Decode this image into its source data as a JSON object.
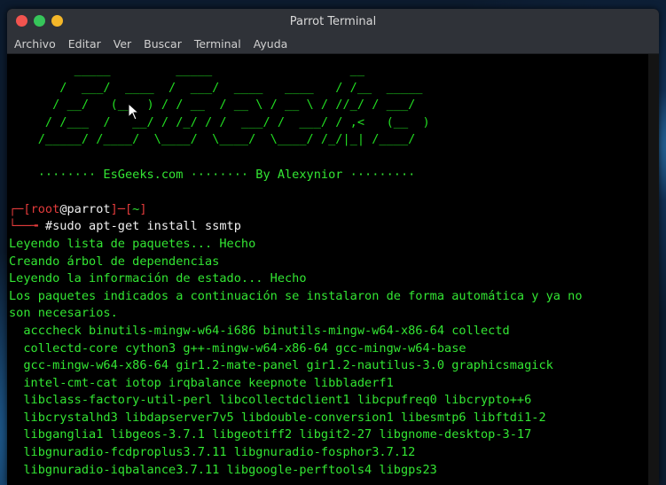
{
  "window": {
    "title": "Parrot Terminal",
    "controls": [
      "close",
      "maximize",
      "minimize"
    ]
  },
  "menu": [
    "Archivo",
    "Editar",
    "Ver",
    "Buscar",
    "Terminal",
    "Ayuda"
  ],
  "banner": {
    "art": [
      "         _____         _____                   __",
      "       /  ___/  ____  /  ___/  ____   ____   / /__  _____",
      "      / __/   (__  ) / / __  / __ \\ / __ \\ / //_/ / ___/",
      "     / /___  /   __/ / /_/ / /  ___/ /  ___/ / ,<   (__  )",
      "    /_____/ /____/  \\____/  \\____/  \\____/ /_/|_| /____/"
    ],
    "footer": "    ········ EsGeeks.com ········ By Alexynior ·········"
  },
  "prompt": {
    "user": "root",
    "at": "@",
    "host": "parrot",
    "dir": "~",
    "command": "#sudo apt-get install ssmtp"
  },
  "output": [
    "Leyendo lista de paquetes... Hecho",
    "Creando árbol de dependencias",
    "Leyendo la información de estado... Hecho",
    "Los paquetes indicados a continuación se instalaron de forma automática y ya no",
    "son necesarios.",
    "  acccheck binutils-mingw-w64-i686 binutils-mingw-w64-x86-64 collectd",
    "  collectd-core cython3 g++-mingw-w64-x86-64 gcc-mingw-w64-base",
    "  gcc-mingw-w64-x86-64 gir1.2-mate-panel gir1.2-nautilus-3.0 graphicsmagick",
    "  intel-cmt-cat iotop irqbalance keepnote libbladerf1",
    "  libclass-factory-util-perl libcollectdclient1 libcpufreq0 libcrypto++6",
    "  libcrystalhd3 libdapserver7v5 libdouble-conversion1 libesmtp6 libftdi1-2",
    "  libganglia1 libgeos-3.7.1 libgeotiff2 libgit2-27 libgnome-desktop-3-17",
    "  libgnuradio-fcdproplus3.7.11 libgnuradio-fosphor3.7.12",
    "  libgnuradio-iqbalance3.7.11 libgoogle-perftools4 libgps23"
  ]
}
